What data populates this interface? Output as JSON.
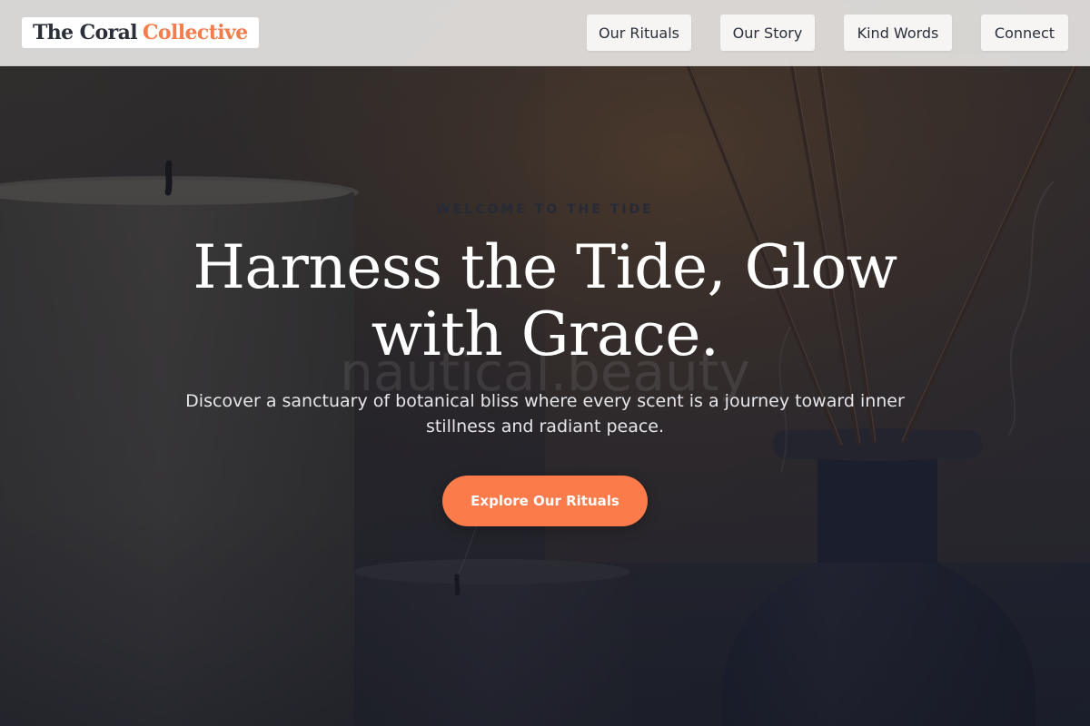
{
  "brand": {
    "name_part1": "The Coral",
    "name_part2": "Collective",
    "accent_color": "#f47c4c",
    "text_color": "#2b2f3a"
  },
  "nav": {
    "items": [
      {
        "label": "Our Rituals"
      },
      {
        "label": "Our Story"
      },
      {
        "label": "Kind Words"
      },
      {
        "label": "Connect"
      }
    ]
  },
  "hero": {
    "eyebrow": "WELCOME TO THE TIDE",
    "headline": "Harness the Tide, Glow with Grace.",
    "subheadline": "Discover a sanctuary of botanical bliss where every scent is a journey toward inner stillness and radiant peace.",
    "watermark": "nautical.beauty",
    "cta_label": "Explore Our Rituals",
    "cta_color": "#fb7b4b",
    "background_image": "candles-and-reed-diffuser-photo"
  }
}
